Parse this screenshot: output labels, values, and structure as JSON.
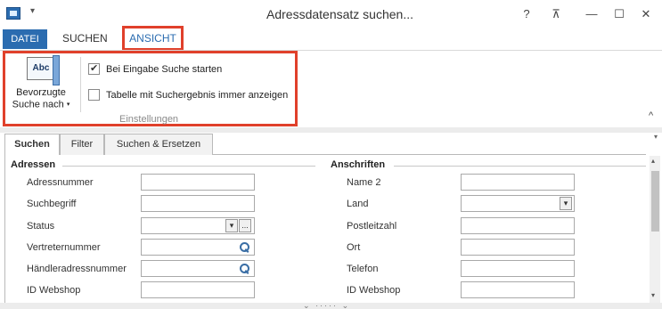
{
  "window": {
    "title": "Adressdatensatz suchen...",
    "qa_arrow": "▾",
    "buttons": {
      "help": "?",
      "restore_small": "⊼",
      "minimize": "—",
      "maximize": "☐",
      "close": "✕"
    }
  },
  "ribbon": {
    "tabs": {
      "file": "DATEI",
      "search": "SUCHEN",
      "view": "ANSICHT"
    },
    "preferred_search": {
      "icon_text": "Abc",
      "line1": "Bevorzugte",
      "line2": "Suche nach",
      "caret": "▾"
    },
    "options": [
      {
        "label": "Bei Eingabe Suche starten",
        "checked": true
      },
      {
        "label": "Tabelle mit Suchergebnis immer anzeigen",
        "checked": false
      }
    ],
    "group_label": "Einstellungen",
    "collapse_icon": "^"
  },
  "tabs": [
    "Suchen",
    "Filter",
    "Suchen & Ersetzen"
  ],
  "sections": {
    "adressen": {
      "title": "Adressen",
      "fields": [
        "Adressnummer",
        "Suchbegriff",
        "Status",
        "Vertreternummer",
        "Händleradressnummer",
        "ID Webshop"
      ]
    },
    "anschriften": {
      "title": "Anschriften",
      "fields": [
        "Name 2",
        "Land",
        "Postleitzahl",
        "Ort",
        "Telefon",
        "ID Webshop"
      ]
    }
  },
  "glyphs": {
    "dropdown": "▾",
    "ellipsis": "...",
    "scroll_up": "▴",
    "scroll_down": "▾",
    "splitter_left": "⌄",
    "splitter_dots": "·····",
    "splitter_right": "⌄"
  }
}
